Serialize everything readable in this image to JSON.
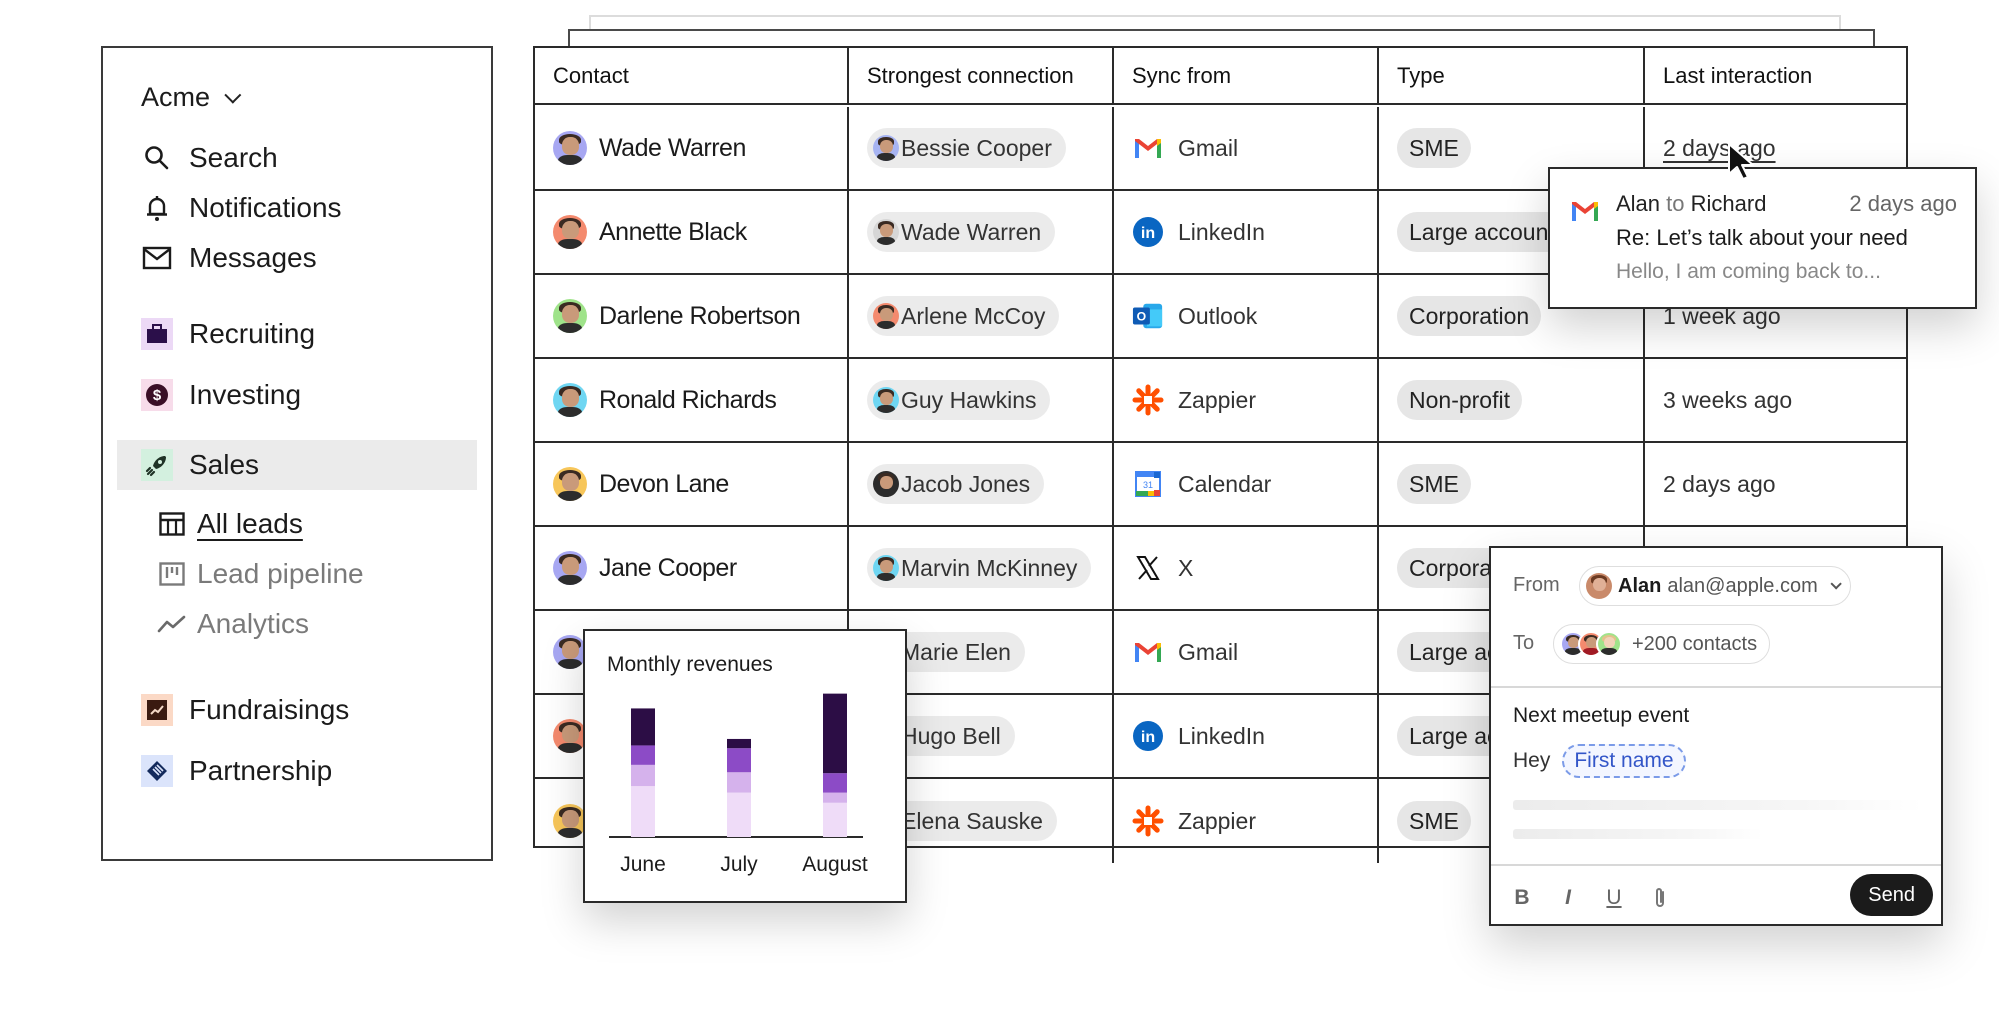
{
  "sidebar": {
    "workspace": "Acme",
    "primary": [
      {
        "label": "Search",
        "icon": "search-icon"
      },
      {
        "label": "Notifications",
        "icon": "bell-icon"
      },
      {
        "label": "Messages",
        "icon": "mail-icon"
      }
    ],
    "spaces": [
      {
        "label": "Recruiting",
        "icon": "briefcase-icon",
        "bg": "#ecd9f6",
        "fg": "#2b0f4a"
      },
      {
        "label": "Investing",
        "icon": "dollar-icon",
        "bg": "#f7dcea",
        "fg": "#3a0f26"
      },
      {
        "label": "Sales",
        "icon": "rocket-icon",
        "bg": "#d3f0df",
        "fg": "#1f3327",
        "selected": true
      },
      {
        "label": "Fundraisings",
        "icon": "trend-icon",
        "bg": "#fbd9c6",
        "fg": "#3a1a10"
      },
      {
        "label": "Partnership",
        "icon": "handshake-icon",
        "bg": "#dbe4fb",
        "fg": "#132a5c"
      }
    ],
    "sales_views": [
      {
        "label": "All leads",
        "icon": "table-icon",
        "active": true
      },
      {
        "label": "Lead pipeline",
        "icon": "kanban-icon",
        "active": false
      },
      {
        "label": "Analytics",
        "icon": "line-chart-icon",
        "active": false
      }
    ]
  },
  "table": {
    "columns": [
      "Contact",
      "Strongest connection",
      "Sync from",
      "Type",
      "Last interaction"
    ],
    "rows": [
      {
        "contact": "Wade Warren",
        "avatar": "#a7a7f2",
        "connection": "Bessie Cooper",
        "conn_avatar": "#a7b4f2",
        "sync": "Gmail",
        "type": "SME",
        "last": "2 days ago"
      },
      {
        "contact": "Annette Black",
        "avatar": "#f48a6e",
        "connection": "Wade Warren",
        "conn_avatar": "#d6d6d6",
        "sync": "LinkedIn",
        "type": "Large account",
        "last": ""
      },
      {
        "contact": "Darlene Robertson",
        "avatar": "#9fe38a",
        "connection": "Arlene McCoy",
        "conn_avatar": "#f48a6e",
        "sync": "Outlook",
        "type": "Corporation",
        "last": "1 week ago"
      },
      {
        "contact": "Ronald Richards",
        "avatar": "#6fd6f2",
        "connection": "Guy Hawkins",
        "conn_avatar": "#6fd6f2",
        "sync": "Zappier",
        "type": "Non-profit",
        "last": "3 weeks ago"
      },
      {
        "contact": "Devon Lane",
        "avatar": "#f7c65a",
        "connection": "Jacob Jones",
        "conn_avatar": "#2b2b2b",
        "sync": "Calendar",
        "type": "SME",
        "last": "2 days ago"
      },
      {
        "contact": "Jane Cooper",
        "avatar": "#a7a7f2",
        "connection": "Marvin McKinney",
        "conn_avatar": "#6fd6f2",
        "sync": "X",
        "type": "Corporation",
        "last": ""
      },
      {
        "contact": "",
        "avatar": "#a7a7f2",
        "connection": "Marie Elen",
        "conn_avatar": "#d6d6d6",
        "sync": "Gmail",
        "type": "Large account",
        "last": ""
      },
      {
        "contact": "",
        "avatar": "#f48a6e",
        "connection": "Hugo Bell",
        "conn_avatar": "#d6d6d6",
        "sync": "LinkedIn",
        "type": "Large account",
        "last": ""
      },
      {
        "contact": "",
        "avatar": "#f7c65a",
        "connection": "Elena Sauske",
        "conn_avatar": "#d6d6d6",
        "sync": "Zappier",
        "type": "SME",
        "last": ""
      }
    ]
  },
  "tooltip": {
    "sender": "Alan",
    "to_word": "to",
    "recipient": "Richard",
    "when": "2 days ago",
    "subject": "Re: Let’s talk about your need",
    "preview": "Hello, I am coming back to..."
  },
  "chart_data": {
    "type": "bar",
    "stacked": true,
    "title": "Monthly revenues",
    "categories": [
      "June",
      "July",
      "August"
    ],
    "series": [
      {
        "name": "segment-1",
        "color": "#efdcf8",
        "values": [
          55,
          48,
          37
        ]
      },
      {
        "name": "segment-2",
        "color": "#d5b2ec",
        "values": [
          23,
          22,
          11
        ]
      },
      {
        "name": "segment-3",
        "color": "#8c4bc6",
        "values": [
          21,
          26,
          21
        ]
      },
      {
        "name": "segment-4",
        "color": "#2c0d45",
        "values": [
          40,
          10,
          86
        ]
      }
    ],
    "xlabel": "",
    "ylabel": "",
    "ylim": [
      0,
      160
    ],
    "grid": false,
    "legend": "none"
  },
  "composer": {
    "from_label": "From",
    "from_name": "Alan",
    "from_email": "alan@apple.com",
    "to_label": "To",
    "to_count": "+200 contacts",
    "subject": "Next meetup event",
    "greeting": "Hey",
    "variable": "First name",
    "format_buttons": [
      "B",
      "I",
      "U"
    ],
    "send_label": "Send"
  }
}
